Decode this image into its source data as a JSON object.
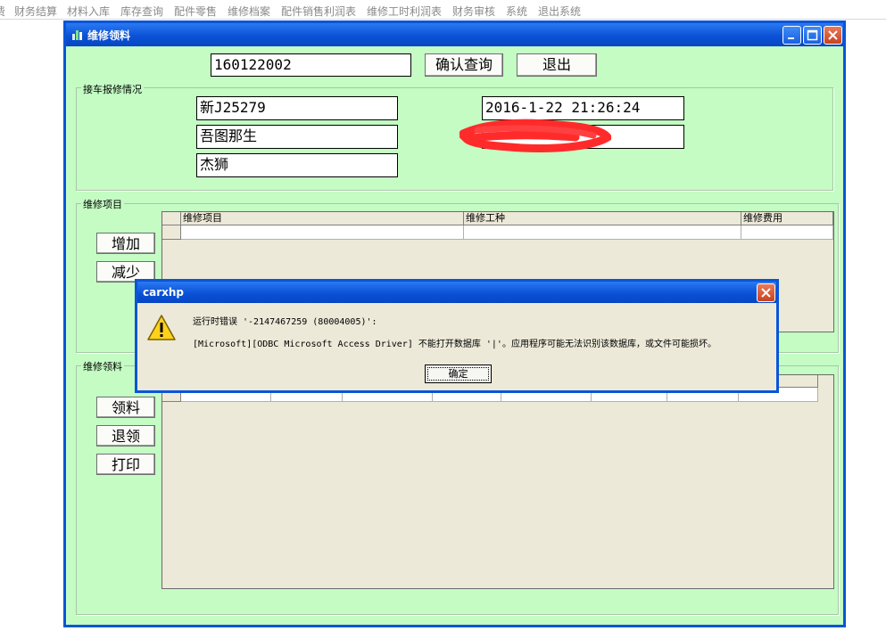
{
  "menubar": {
    "items": [
      {
        "label": "费"
      },
      {
        "label": "财务结算"
      },
      {
        "label": "材料入库"
      },
      {
        "label": "库存查询"
      },
      {
        "label": "配件零售"
      },
      {
        "label": "维修档案"
      },
      {
        "label": "配件销售利润表"
      },
      {
        "label": "维修工时利润表"
      },
      {
        "label": "财务审核"
      },
      {
        "label": "系统"
      },
      {
        "label": "退出系统"
      }
    ]
  },
  "window": {
    "title": "维修领料",
    "search": {
      "value": "160122002"
    },
    "confirm_query_label": "确认查询",
    "exit_label": "退出",
    "reception": {
      "legend": "接车报修情况",
      "plate": "新J25279",
      "owner": "吾图那生",
      "model": "杰狮",
      "datetime": "2016-1-22 21:26:24",
      "phone": ""
    },
    "repair_items": {
      "legend": "维修项目",
      "add_label": "增加",
      "remove_label": "减少",
      "columns": [
        "维修项目",
        "维修工种",
        "维修费用"
      ]
    },
    "repair_materials": {
      "legend": "维修领料",
      "pick_label": "领料",
      "return_label": "退领",
      "print_label": "打印"
    }
  },
  "dialog": {
    "title": "carxhp",
    "message_line1": "运行时错误 '-2147467259 (80004005)':",
    "message_line2": "[Microsoft][ODBC Microsoft Access Driver] 不能打开数据库 '|'。应用程序可能无法识别该数据库，或文件可能损坏。",
    "ok_label": "确定",
    "icon": "warning-icon"
  },
  "colors": {
    "title_bar": "#0b52d6",
    "form_background": "#c4fcc4",
    "redaction": "#ff2b2b"
  }
}
